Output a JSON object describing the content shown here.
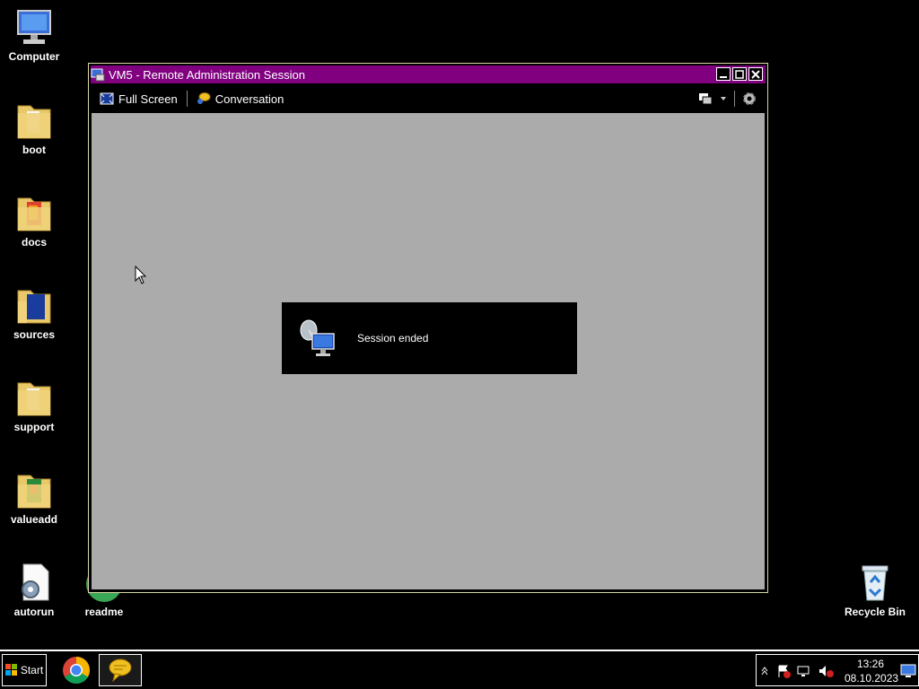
{
  "desktop": {
    "icons": [
      {
        "label": "Computer"
      },
      {
        "label": "boot"
      },
      {
        "label": "docs"
      },
      {
        "label": "sources"
      },
      {
        "label": "support"
      },
      {
        "label": "valueadd"
      },
      {
        "label": "autorun"
      },
      {
        "label": "readme"
      },
      {
        "label": "Recycle Bin"
      }
    ]
  },
  "window": {
    "title": "VM5 - Remote Administration Session",
    "toolbar": {
      "full_screen": "Full Screen",
      "conversation": "Conversation"
    },
    "toast": {
      "message": "Session ended"
    },
    "accent_color": "#800080"
  },
  "taskbar": {
    "start_label": "Start",
    "clock_time": "13:26",
    "clock_date": "08.10.2023"
  }
}
